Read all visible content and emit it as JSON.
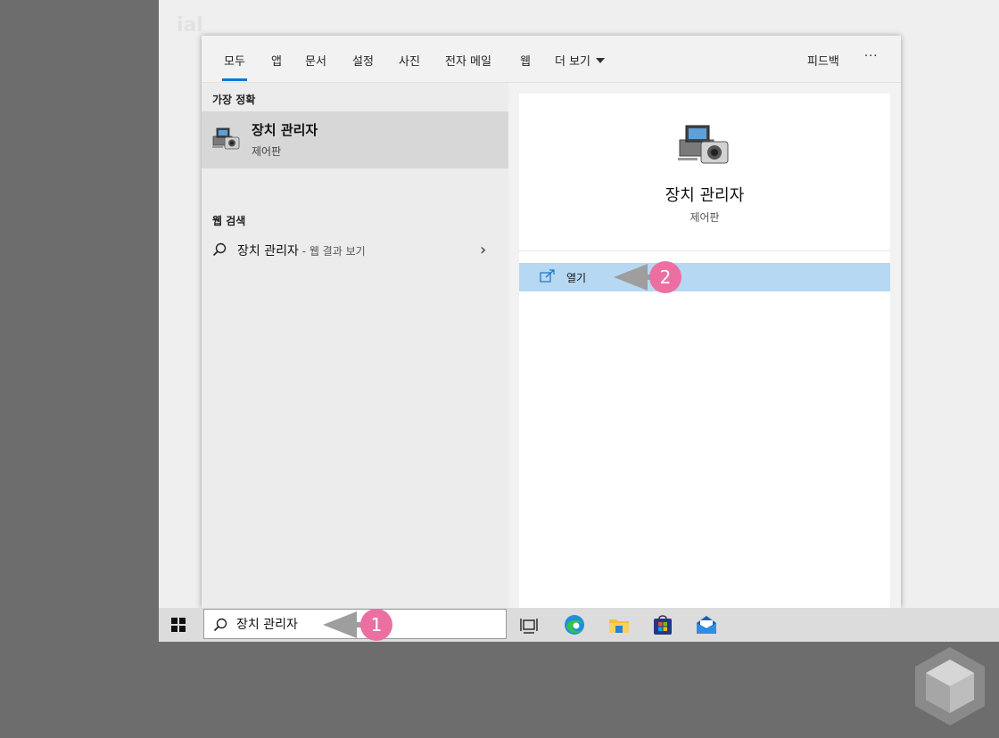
{
  "tabs": [
    {
      "label": "모두",
      "active": true
    },
    {
      "label": "앱"
    },
    {
      "label": "문서"
    },
    {
      "label": "설정"
    },
    {
      "label": "사진"
    },
    {
      "label": "전자 메일"
    },
    {
      "label": "웹"
    },
    {
      "label": "더 보기"
    }
  ],
  "header_right": {
    "feedback": "피드백",
    "more": "···"
  },
  "best_match": {
    "heading": "가장 정확",
    "title": "장치 관리자",
    "subtitle": "제어판",
    "icon": "device-manager-icon"
  },
  "web_search": {
    "heading": "웹 검색",
    "query": "장치 관리자",
    "suffix": " - 웹 결과 보기"
  },
  "detail": {
    "title": "장치 관리자",
    "subtitle": "제어판",
    "open_label": "열기"
  },
  "taskbar": {
    "search_value": "장치 관리자",
    "icons": [
      "windows-start-icon",
      "search-icon",
      "task-view-icon",
      "edge-icon",
      "file-explorer-icon",
      "store-icon",
      "mail-icon"
    ]
  },
  "callouts": {
    "one": "1",
    "two": "2"
  },
  "colors": {
    "accent": "#0078d4",
    "highlight": "#b7d8f2",
    "badge": "#ec6fa2"
  }
}
